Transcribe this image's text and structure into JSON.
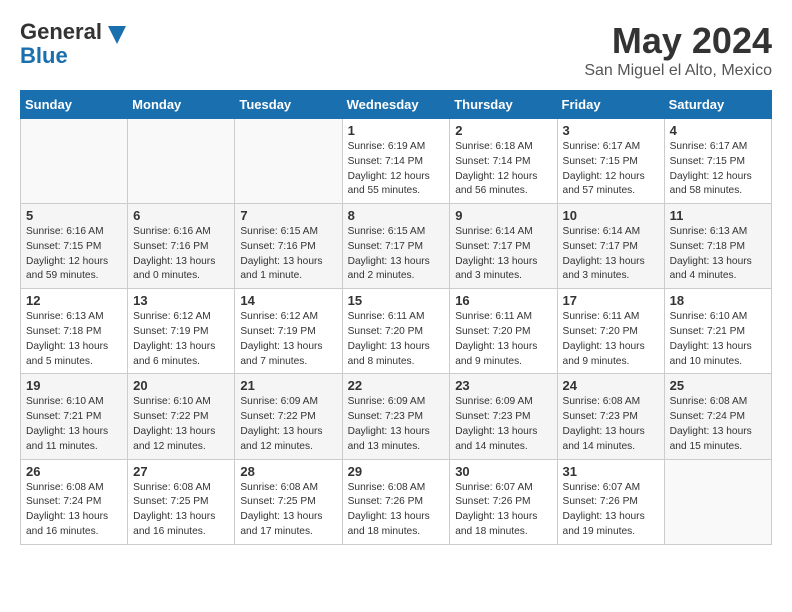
{
  "header": {
    "logo_general": "General",
    "logo_blue": "Blue",
    "month_year": "May 2024",
    "location": "San Miguel el Alto, Mexico"
  },
  "weekdays": [
    "Sunday",
    "Monday",
    "Tuesday",
    "Wednesday",
    "Thursday",
    "Friday",
    "Saturday"
  ],
  "weeks": [
    [
      {
        "day": "",
        "info": ""
      },
      {
        "day": "",
        "info": ""
      },
      {
        "day": "",
        "info": ""
      },
      {
        "day": "1",
        "info": "Sunrise: 6:19 AM\nSunset: 7:14 PM\nDaylight: 12 hours\nand 55 minutes."
      },
      {
        "day": "2",
        "info": "Sunrise: 6:18 AM\nSunset: 7:14 PM\nDaylight: 12 hours\nand 56 minutes."
      },
      {
        "day": "3",
        "info": "Sunrise: 6:17 AM\nSunset: 7:15 PM\nDaylight: 12 hours\nand 57 minutes."
      },
      {
        "day": "4",
        "info": "Sunrise: 6:17 AM\nSunset: 7:15 PM\nDaylight: 12 hours\nand 58 minutes."
      }
    ],
    [
      {
        "day": "5",
        "info": "Sunrise: 6:16 AM\nSunset: 7:15 PM\nDaylight: 12 hours\nand 59 minutes."
      },
      {
        "day": "6",
        "info": "Sunrise: 6:16 AM\nSunset: 7:16 PM\nDaylight: 13 hours\nand 0 minutes."
      },
      {
        "day": "7",
        "info": "Sunrise: 6:15 AM\nSunset: 7:16 PM\nDaylight: 13 hours\nand 1 minute."
      },
      {
        "day": "8",
        "info": "Sunrise: 6:15 AM\nSunset: 7:17 PM\nDaylight: 13 hours\nand 2 minutes."
      },
      {
        "day": "9",
        "info": "Sunrise: 6:14 AM\nSunset: 7:17 PM\nDaylight: 13 hours\nand 3 minutes."
      },
      {
        "day": "10",
        "info": "Sunrise: 6:14 AM\nSunset: 7:17 PM\nDaylight: 13 hours\nand 3 minutes."
      },
      {
        "day": "11",
        "info": "Sunrise: 6:13 AM\nSunset: 7:18 PM\nDaylight: 13 hours\nand 4 minutes."
      }
    ],
    [
      {
        "day": "12",
        "info": "Sunrise: 6:13 AM\nSunset: 7:18 PM\nDaylight: 13 hours\nand 5 minutes."
      },
      {
        "day": "13",
        "info": "Sunrise: 6:12 AM\nSunset: 7:19 PM\nDaylight: 13 hours\nand 6 minutes."
      },
      {
        "day": "14",
        "info": "Sunrise: 6:12 AM\nSunset: 7:19 PM\nDaylight: 13 hours\nand 7 minutes."
      },
      {
        "day": "15",
        "info": "Sunrise: 6:11 AM\nSunset: 7:20 PM\nDaylight: 13 hours\nand 8 minutes."
      },
      {
        "day": "16",
        "info": "Sunrise: 6:11 AM\nSunset: 7:20 PM\nDaylight: 13 hours\nand 9 minutes."
      },
      {
        "day": "17",
        "info": "Sunrise: 6:11 AM\nSunset: 7:20 PM\nDaylight: 13 hours\nand 9 minutes."
      },
      {
        "day": "18",
        "info": "Sunrise: 6:10 AM\nSunset: 7:21 PM\nDaylight: 13 hours\nand 10 minutes."
      }
    ],
    [
      {
        "day": "19",
        "info": "Sunrise: 6:10 AM\nSunset: 7:21 PM\nDaylight: 13 hours\nand 11 minutes."
      },
      {
        "day": "20",
        "info": "Sunrise: 6:10 AM\nSunset: 7:22 PM\nDaylight: 13 hours\nand 12 minutes."
      },
      {
        "day": "21",
        "info": "Sunrise: 6:09 AM\nSunset: 7:22 PM\nDaylight: 13 hours\nand 12 minutes."
      },
      {
        "day": "22",
        "info": "Sunrise: 6:09 AM\nSunset: 7:23 PM\nDaylight: 13 hours\nand 13 minutes."
      },
      {
        "day": "23",
        "info": "Sunrise: 6:09 AM\nSunset: 7:23 PM\nDaylight: 13 hours\nand 14 minutes."
      },
      {
        "day": "24",
        "info": "Sunrise: 6:08 AM\nSunset: 7:23 PM\nDaylight: 13 hours\nand 14 minutes."
      },
      {
        "day": "25",
        "info": "Sunrise: 6:08 AM\nSunset: 7:24 PM\nDaylight: 13 hours\nand 15 minutes."
      }
    ],
    [
      {
        "day": "26",
        "info": "Sunrise: 6:08 AM\nSunset: 7:24 PM\nDaylight: 13 hours\nand 16 minutes."
      },
      {
        "day": "27",
        "info": "Sunrise: 6:08 AM\nSunset: 7:25 PM\nDaylight: 13 hours\nand 16 minutes."
      },
      {
        "day": "28",
        "info": "Sunrise: 6:08 AM\nSunset: 7:25 PM\nDaylight: 13 hours\nand 17 minutes."
      },
      {
        "day": "29",
        "info": "Sunrise: 6:08 AM\nSunset: 7:26 PM\nDaylight: 13 hours\nand 18 minutes."
      },
      {
        "day": "30",
        "info": "Sunrise: 6:07 AM\nSunset: 7:26 PM\nDaylight: 13 hours\nand 18 minutes."
      },
      {
        "day": "31",
        "info": "Sunrise: 6:07 AM\nSunset: 7:26 PM\nDaylight: 13 hours\nand 19 minutes."
      },
      {
        "day": "",
        "info": ""
      }
    ]
  ]
}
